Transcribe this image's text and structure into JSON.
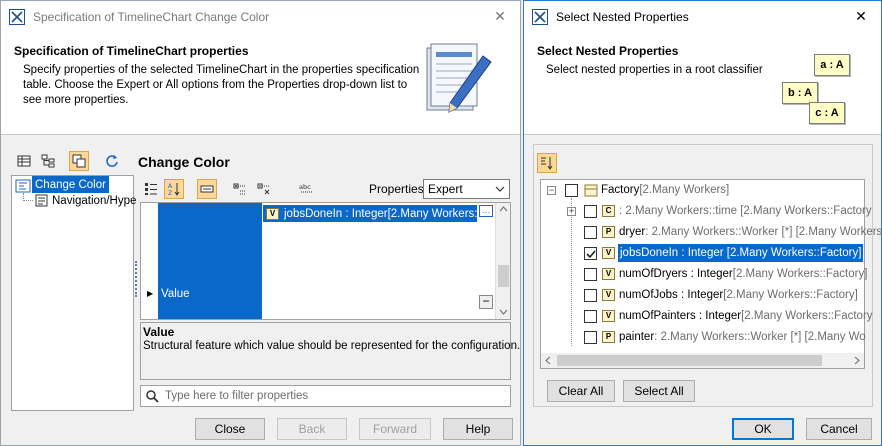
{
  "spec_window": {
    "title": "Specification of TimelineChart Change Color",
    "close_glyph": "✕",
    "header_title": "Specification of TimelineChart properties",
    "header_desc_lines": [
      "Specify properties of the selected TimelineChart in the properties specification",
      "table. Choose the Expert or All options from the Properties drop-down list to",
      "see more properties."
    ],
    "section_title": "Change Color",
    "tree": {
      "root": "Change Color",
      "child": "Navigation/Hype"
    },
    "properties_label": "Properties:",
    "properties_value": "Expert",
    "grid": {
      "row_label": "Value",
      "value_name": "jobsDoneIn : Integer",
      "value_extra": " [2.Many Workers:"
    },
    "desc_title": "Value",
    "desc_text": "Structural feature which value should be represented for the configuration.",
    "filter_placeholder": "Type here to filter properties",
    "buttons": {
      "close": "Close",
      "back": "Back",
      "forward": "Forward",
      "help": "Help"
    }
  },
  "nested_window": {
    "title": "Select Nested Properties",
    "close_glyph": "✕",
    "header_title": "Select Nested Properties",
    "header_desc": "Select nested properties in a root classifier",
    "notes": [
      "a : A",
      "b : A",
      "c : A"
    ],
    "tree": {
      "root": {
        "name": "Factory",
        "extra": " [2.Many Workers]"
      },
      "items": [
        {
          "icon": "C",
          "name": "",
          "extra": " : 2.Many Workers::time [2.Many Workers::Factory",
          "checked": false,
          "selected": false,
          "expandable": true
        },
        {
          "icon": "P",
          "name": "dryer",
          "extra": " : 2.Many Workers::Worker [*] [2.Many Workers::F",
          "checked": false,
          "selected": false,
          "expandable": false
        },
        {
          "icon": "V",
          "name": "jobsDoneIn : Integer [2.Many Workers::Factory]",
          "extra": "",
          "checked": true,
          "selected": true,
          "expandable": false
        },
        {
          "icon": "V",
          "name": "numOfDryers : Integer",
          "extra": " [2.Many Workers::Factory]",
          "checked": false,
          "selected": false,
          "expandable": false
        },
        {
          "icon": "V",
          "name": "numOfJobs : Integer",
          "extra": " [2.Many Workers::Factory]",
          "checked": false,
          "selected": false,
          "expandable": false
        },
        {
          "icon": "V",
          "name": "numOfPainters : Integer",
          "extra": " [2.Many Workers::Factory",
          "checked": false,
          "selected": false,
          "expandable": false
        },
        {
          "icon": "P",
          "name": "painter",
          "extra": " : 2.Many Workers::Worker [*] [2.Many Wo",
          "checked": false,
          "selected": false,
          "expandable": false
        }
      ]
    },
    "buttons": {
      "clear_all": "Clear All",
      "select_all": "Select All",
      "ok": "OK",
      "cancel": "Cancel"
    }
  }
}
